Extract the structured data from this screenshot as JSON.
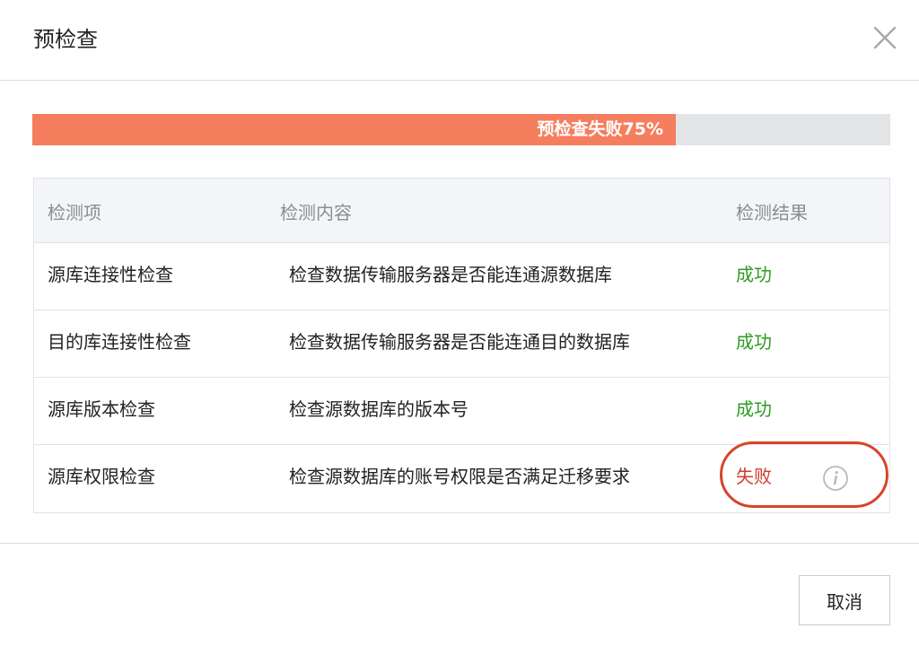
{
  "dialog": {
    "title": "预检查",
    "close_icon": "close-icon"
  },
  "progress": {
    "label": "预检查失败75%",
    "percent": 75,
    "fill_color": "#f47e5e",
    "track_color": "#e2e4e6"
  },
  "table": {
    "headers": {
      "item": "检测项",
      "content": "检测内容",
      "result": "检测结果"
    },
    "rows": [
      {
        "item": "源库连接性检查",
        "content": "检查数据传输服务器是否能连通源数据库",
        "result": "成功",
        "status": "success"
      },
      {
        "item": "目的库连接性检查",
        "content": "检查数据传输服务器是否能连通目的数据库",
        "result": "成功",
        "status": "success"
      },
      {
        "item": "源库版本检查",
        "content": "检查源数据库的版本号",
        "result": "成功",
        "status": "success"
      },
      {
        "item": "源库权限检查",
        "content": "检查源数据库的账号权限是否满足迁移要求",
        "result": "失败",
        "status": "fail",
        "info_icon": "info-icon"
      }
    ]
  },
  "colors": {
    "success": "#2e9b20",
    "fail": "#d33b2c",
    "highlight": "#d8432a"
  },
  "footer": {
    "cancel_label": "取消"
  }
}
